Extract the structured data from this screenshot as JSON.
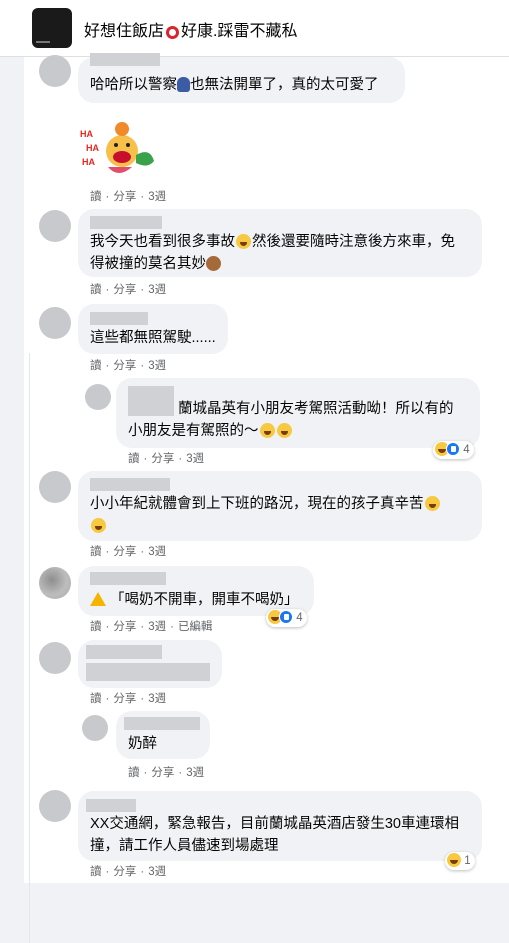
{
  "header": {
    "title_part1": "好想住飯店",
    "title_part2": "好康.踩雷不藏私"
  },
  "actions": {
    "read": "讀",
    "share": "分享",
    "sep": "·"
  },
  "comments": [
    {
      "text": "哈哈所以警察",
      "text2": "也無法開單了，真的太可愛了",
      "time": "3週"
    },
    {
      "sticker_text": "HA HA HA",
      "time": "3週"
    },
    {
      "line1": "我今天也看到很多事故",
      "line1b": "然後還要隨時注意後方來車，免",
      "line2": "得被撞的莫名其妙",
      "time": "3週"
    },
    {
      "text": "這些都無照駕駛......",
      "time": "3週"
    },
    {
      "line1": "蘭城晶英有小朋友考駕照活動呦！所以有的",
      "line2": "小朋友是有駕照的～",
      "time": "3週",
      "reactions": "4"
    },
    {
      "line1": "小小年紀就體會到上下班的路況，現在的孩子真辛苦",
      "time": "3週"
    },
    {
      "text": "「喝奶不開車，開車不喝奶」",
      "time": "3週",
      "edited": "已編輯",
      "reactions": "4"
    },
    {
      "time": "3週"
    },
    {
      "text": "奶醉",
      "time": "3週"
    },
    {
      "line1": "XX交通網，緊急報告，目前蘭城晶英酒店發生30車連環相",
      "line2": "撞，請工作人員儘速到場處理",
      "time": "3週",
      "reactions": "1"
    }
  ]
}
